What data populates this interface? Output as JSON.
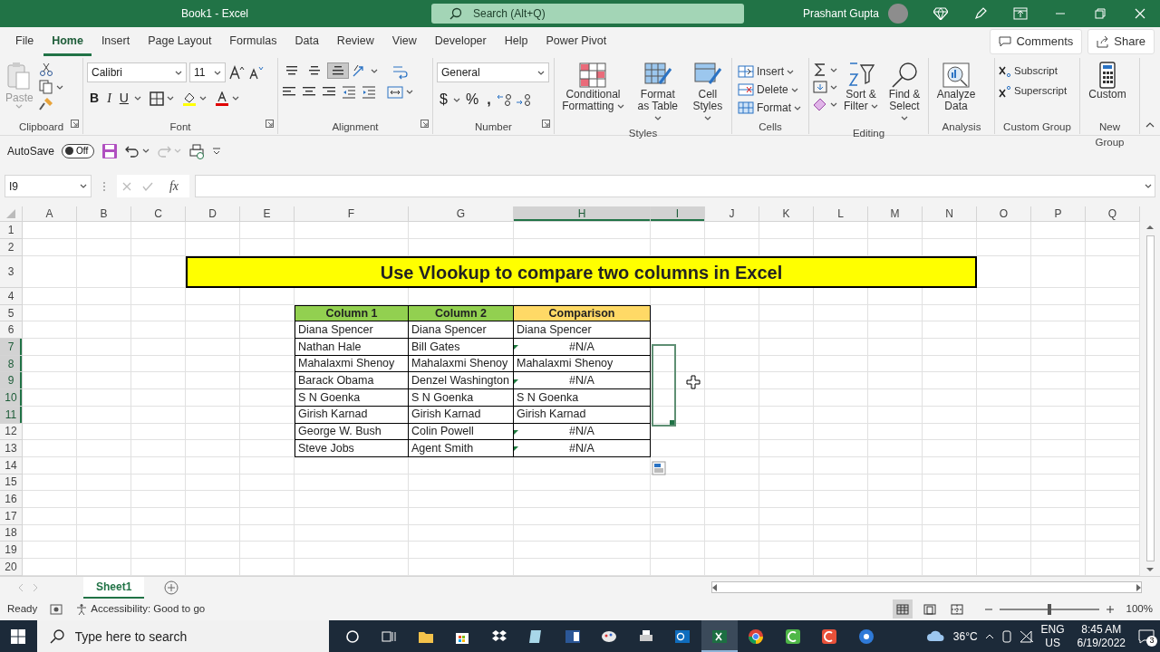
{
  "window": {
    "title": "Book1  -  Excel",
    "search_placeholder": "Search (Alt+Q)",
    "user": "Prashant Gupta"
  },
  "menu_tabs": [
    {
      "label": "File",
      "selected": false
    },
    {
      "label": "Home",
      "selected": true
    },
    {
      "label": "Insert",
      "selected": false
    },
    {
      "label": "Page Layout",
      "selected": false
    },
    {
      "label": "Formulas",
      "selected": false
    },
    {
      "label": "Data",
      "selected": false
    },
    {
      "label": "Review",
      "selected": false
    },
    {
      "label": "View",
      "selected": false
    },
    {
      "label": "Developer",
      "selected": false
    },
    {
      "label": "Help",
      "selected": false
    },
    {
      "label": "Power Pivot",
      "selected": false
    }
  ],
  "actions": [
    "Comments",
    "Share"
  ],
  "ribbon": {
    "clipboard": {
      "label": "Clipboard",
      "paste": "Paste",
      "paste_disabled": true
    },
    "font": {
      "label": "Font",
      "font_name": "Calibri",
      "font_size": "11",
      "styles": [
        "B",
        "I",
        "U"
      ]
    },
    "alignment": {
      "label": "Alignment",
      "vertical_align": [
        {
          "selected": false
        },
        {
          "selected": false
        },
        {
          "selected": true
        }
      ]
    },
    "number": {
      "label": "Number",
      "format": "General",
      "symbols": [
        "$",
        "%",
        ","
      ]
    },
    "styles": {
      "label": "Styles",
      "buttons": [
        "Conditional Formatting",
        "Format as Table",
        "Cell Styles"
      ]
    },
    "cells": {
      "label": "Cells",
      "buttons": [
        "Insert",
        "Delete",
        "Format"
      ]
    },
    "editing": {
      "label": "Editing",
      "buttons": [
        "Sort & Filter",
        "Find & Select"
      ]
    },
    "analysis": {
      "label": "Analysis",
      "button": "Analyze Data"
    },
    "custom_group": {
      "label": "Custom Group",
      "buttons": [
        "Subscript",
        "Superscript"
      ]
    },
    "new_group": {
      "label": "New Group",
      "button": "Custom"
    }
  },
  "quick_access": {
    "autosave_label": "AutoSave",
    "autosave": {
      "label": "Off",
      "on": false
    },
    "redo_disabled": true
  },
  "formula_bar": {
    "name_box": "I9",
    "fx": "fx"
  },
  "sheet": {
    "columns": [
      {
        "label": "A",
        "selected": false
      },
      {
        "label": "B",
        "selected": false
      },
      {
        "label": "C",
        "selected": false
      },
      {
        "label": "D",
        "selected": false
      },
      {
        "label": "E",
        "selected": false
      },
      {
        "label": "F",
        "selected": false
      },
      {
        "label": "G",
        "selected": false
      },
      {
        "label": "H",
        "selected": true
      },
      {
        "label": "I",
        "selected": true
      },
      {
        "label": "J",
        "selected": false
      },
      {
        "label": "K",
        "selected": false
      },
      {
        "label": "L",
        "selected": false
      },
      {
        "label": "M",
        "selected": false
      },
      {
        "label": "N",
        "selected": false
      },
      {
        "label": "O",
        "selected": false
      },
      {
        "label": "P",
        "selected": false
      },
      {
        "label": "Q",
        "selected": false
      }
    ],
    "rows": [
      {
        "label": "1",
        "selected": false
      },
      {
        "label": "2",
        "selected": false
      },
      {
        "label": "3",
        "selected": false
      },
      {
        "label": "4",
        "selected": false
      },
      {
        "label": "5",
        "selected": false
      },
      {
        "label": "6",
        "selected": false
      },
      {
        "label": "7",
        "selected": true
      },
      {
        "label": "8",
        "selected": true
      },
      {
        "label": "9",
        "selected": true
      },
      {
        "label": "10",
        "selected": true
      },
      {
        "label": "11",
        "selected": true
      },
      {
        "label": "12",
        "selected": false
      },
      {
        "label": "13",
        "selected": false
      },
      {
        "label": "14",
        "selected": false
      },
      {
        "label": "15",
        "selected": false
      },
      {
        "label": "16",
        "selected": false
      },
      {
        "label": "17",
        "selected": false
      },
      {
        "label": "18",
        "selected": false
      },
      {
        "label": "19",
        "selected": false
      },
      {
        "label": "20",
        "selected": false
      }
    ],
    "title": "Use Vlookup to compare two columns in Excel",
    "table": {
      "columns": [
        "Column 1",
        "Column 2",
        "Comparison"
      ],
      "rows": [
        {
          "cells": [
            "Diana Spencer",
            "Diana Spencer",
            "Diana Spencer"
          ],
          "error": false
        },
        {
          "cells": [
            "Nathan Hale",
            "Bill Gates",
            "#N/A"
          ],
          "error": true
        },
        {
          "cells": [
            "Mahalaxmi Shenoy",
            "Mahalaxmi Shenoy",
            "Mahalaxmi Shenoy"
          ],
          "error": false
        },
        {
          "cells": [
            "Barack Obama",
            "Denzel Washington",
            "#N/A"
          ],
          "error": true
        },
        {
          "cells": [
            "S N Goenka",
            "S N Goenka",
            "S N Goenka"
          ],
          "error": false
        },
        {
          "cells": [
            "Girish Karnad",
            "Girish Karnad",
            "Girish Karnad"
          ],
          "error": false
        },
        {
          "cells": [
            "George W. Bush",
            "Colin Powell",
            "#N/A"
          ],
          "error": true
        },
        {
          "cells": [
            "Steve Jobs",
            "Agent Smith",
            "#N/A"
          ],
          "error": true
        }
      ]
    }
  },
  "sheet_tabs": [
    {
      "label": "Sheet1",
      "selected": true
    }
  ],
  "status_bar": {
    "mode": "Ready",
    "accessibility": "Accessibility: Good to go",
    "zoom": "100%",
    "zoom_slider": {
      "level": 0.5
    }
  },
  "taskbar": {
    "search_placeholder": "Type here to search",
    "temperature": "36°C",
    "language": "ENG",
    "region": "US",
    "time": "8:45 AM",
    "date": "6/19/2022",
    "notifications": "3"
  }
}
